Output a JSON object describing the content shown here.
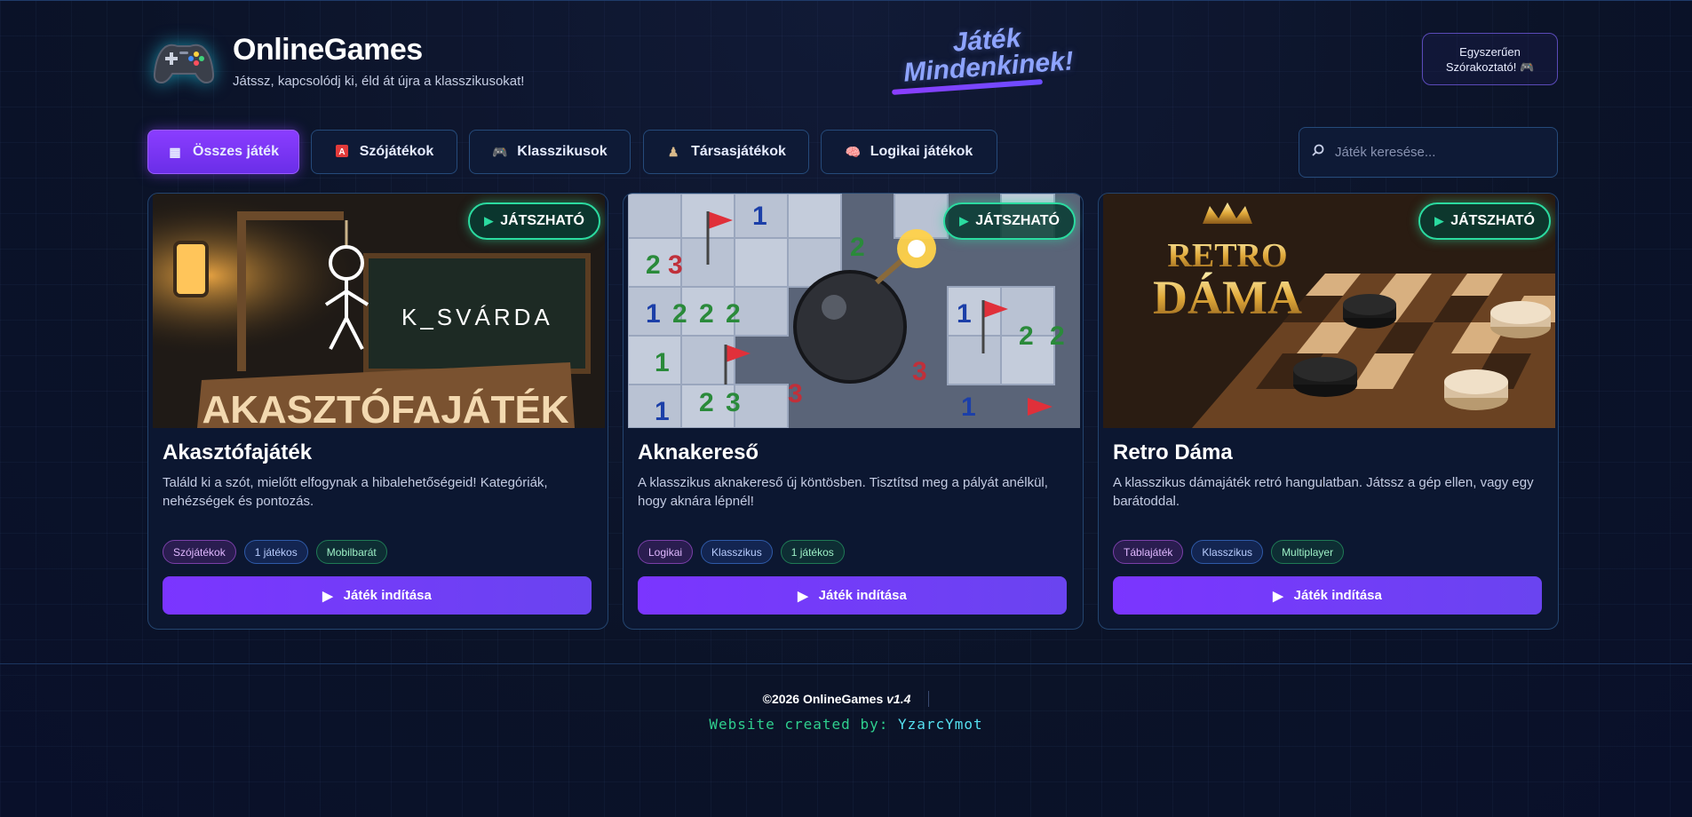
{
  "header": {
    "brand_title": "OnlineGames",
    "brand_subtitle": "Játssz, kapcsolódj ki, éld át újra a klasszikusokat!",
    "slogan_line1": "Játék",
    "slogan_line2": "Mindenkinek!",
    "tagline_line1": "Egyszerűen",
    "tagline_line2": "Szórakoztató! 🎮"
  },
  "tabs": [
    {
      "label": "Összes játék",
      "icon": "▦",
      "active": true
    },
    {
      "label": "Szójátékok",
      "icon": "A"
    },
    {
      "label": "Klasszikusok",
      "icon": "🎮"
    },
    {
      "label": "Társasjátékok",
      "icon": "♟"
    },
    {
      "label": "Logikai játékok",
      "icon": "🧠"
    }
  ],
  "search": {
    "placeholder": "Játék keresése..."
  },
  "cards": [
    {
      "badge": "JÁTSZHATÓ",
      "image_text_1": "K_SVÁRDA",
      "image_text_2": "AKASZTÓFAJÁTÉK",
      "title": "Akasztófajáték",
      "description": "Találd ki a szót, mielőtt elfogynak a hibalehetőségeid! Kategóriák, nehézségek és pontozás.",
      "tags": [
        "Szójátékok",
        "1 játékos",
        "Mobilbarát"
      ],
      "button": "Játék indítása"
    },
    {
      "badge": "JÁTSZHATÓ",
      "title": "Aknakereső",
      "description": "A klasszikus aknakereső új köntösben. Tisztítsd meg a pályát anélkül, hogy aknára lépnél!",
      "tags": [
        "Logikai",
        "Klasszikus",
        "1 játékos"
      ],
      "button": "Játék indítása"
    },
    {
      "badge": "JÁTSZHATÓ",
      "image_text_1": "RETRO",
      "image_text_2": "DÁMA",
      "title": "Retro Dáma",
      "description": "A klasszikus dámajáték retró hangulatban. Játssz a gép ellen, vagy egy barátoddal.",
      "tags": [
        "Táblajáték",
        "Klasszikus",
        "Multiplayer"
      ],
      "button": "Játék indítása"
    }
  ],
  "footer": {
    "copyright": "©2026 OnlineGames",
    "version": "v1.4",
    "credit_prefix": "Website created by:",
    "credit_author": "YzarcYmot"
  },
  "colors": {
    "background": "#0b1328",
    "accent": "#7b35ff",
    "playable_green": "#2bdba0",
    "slogan": "#8ea4ff"
  },
  "icons": [
    "gamepad-icon",
    "grid-icon",
    "letter-a-icon",
    "controller-icon",
    "pawn-icon",
    "brain-icon",
    "search-icon",
    "play-icon"
  ]
}
